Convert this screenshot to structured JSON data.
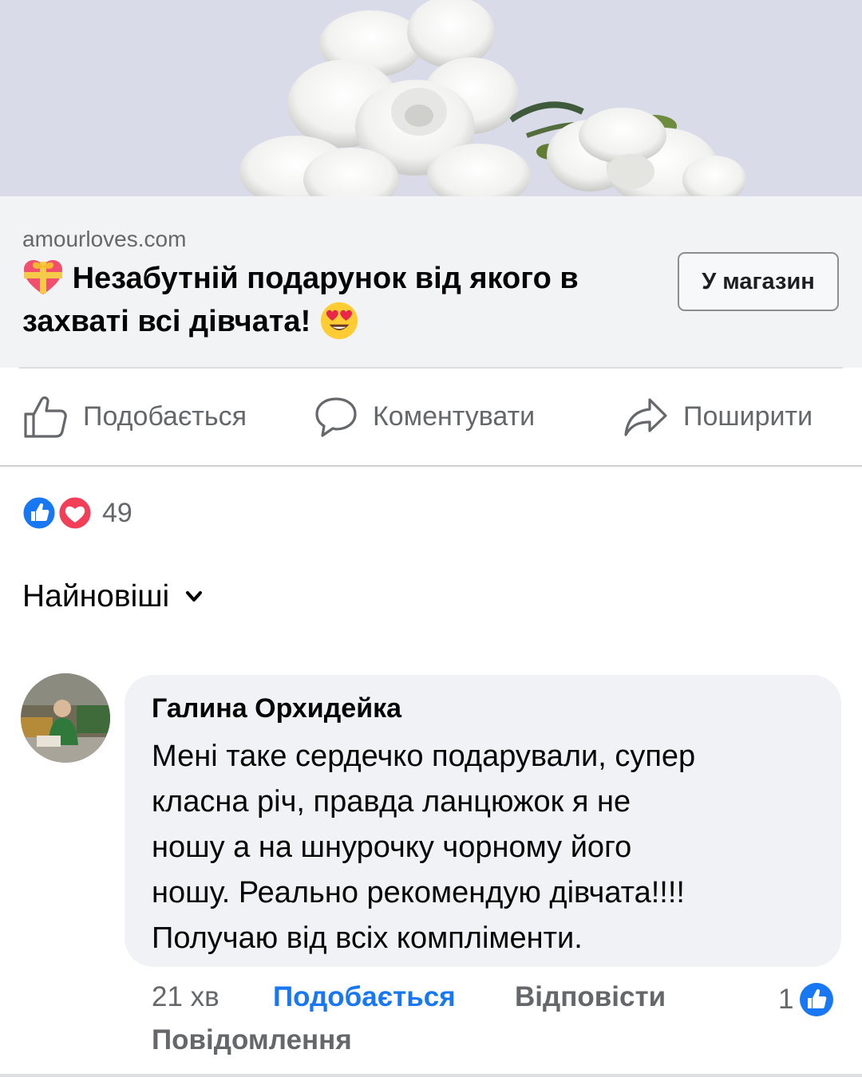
{
  "link_card": {
    "domain": "amourloves.com",
    "title": "Незабутній подарунок від якого в захваті всі дівчата!",
    "leading_emoji_icon": "heart-gift-icon",
    "trailing_emoji_icon": "heart-eyes-emoji-icon",
    "cta_label": "У магазин"
  },
  "actions": {
    "like_label": "Подобається",
    "comment_label": "Коментувати",
    "share_label": "Поширити"
  },
  "reactions": {
    "icons": [
      "like-reaction-icon",
      "love-reaction-icon"
    ],
    "count": "49"
  },
  "sort": {
    "label": "Найновіші"
  },
  "comment": {
    "author": "Галина Орхидейка",
    "lines": [
      "Мені таке сердечко подарували, супер",
      "класна річ, правда ланцюжок я не",
      "ношу а на шнурочку чорному його",
      "ношу. Реально рекомендую дівчата!!!!",
      "Получаю від всіх компліменти."
    ],
    "time": "21 хв",
    "like_label": "Подобається",
    "reply_label": "Відповісти",
    "message_label": "Повідомлення",
    "like_count": "1"
  },
  "colors": {
    "accent_blue": "#1877f2",
    "love_red": "#f33e58",
    "secondary_text": "#65676b",
    "bubble_bg": "#f0f2f5",
    "card_bg": "#f2f3f5"
  }
}
